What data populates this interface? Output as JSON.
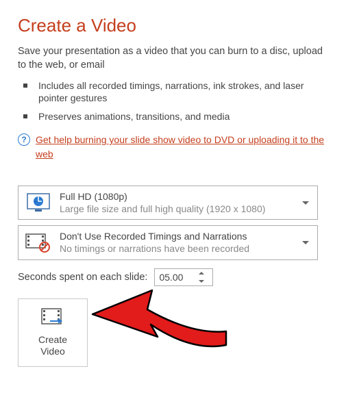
{
  "title": "Create a Video",
  "subtitle": "Save your presentation as a video that you can burn to a disc, upload to the web, or email",
  "bullets": [
    "Includes all recorded timings, narrations, ink strokes, and laser pointer gestures",
    "Preserves animations, transitions, and media"
  ],
  "help": {
    "icon_glyph": "?",
    "link_text": "Get help burning your slide show video to DVD or uploading it to the web"
  },
  "quality_dropdown": {
    "title": "Full HD (1080p)",
    "subtitle": "Large file size and full high quality (1920 x 1080)"
  },
  "timings_dropdown": {
    "title": "Don't Use Recorded Timings and Narrations",
    "subtitle": "No timings or narrations have been recorded"
  },
  "seconds": {
    "label": "Seconds spent on each slide:",
    "value": "05.00"
  },
  "create_button": {
    "label": "Create\nVideo"
  },
  "colors": {
    "accent": "#c43e1c",
    "link_blue": "#2b7cd3",
    "muted": "#888888"
  }
}
